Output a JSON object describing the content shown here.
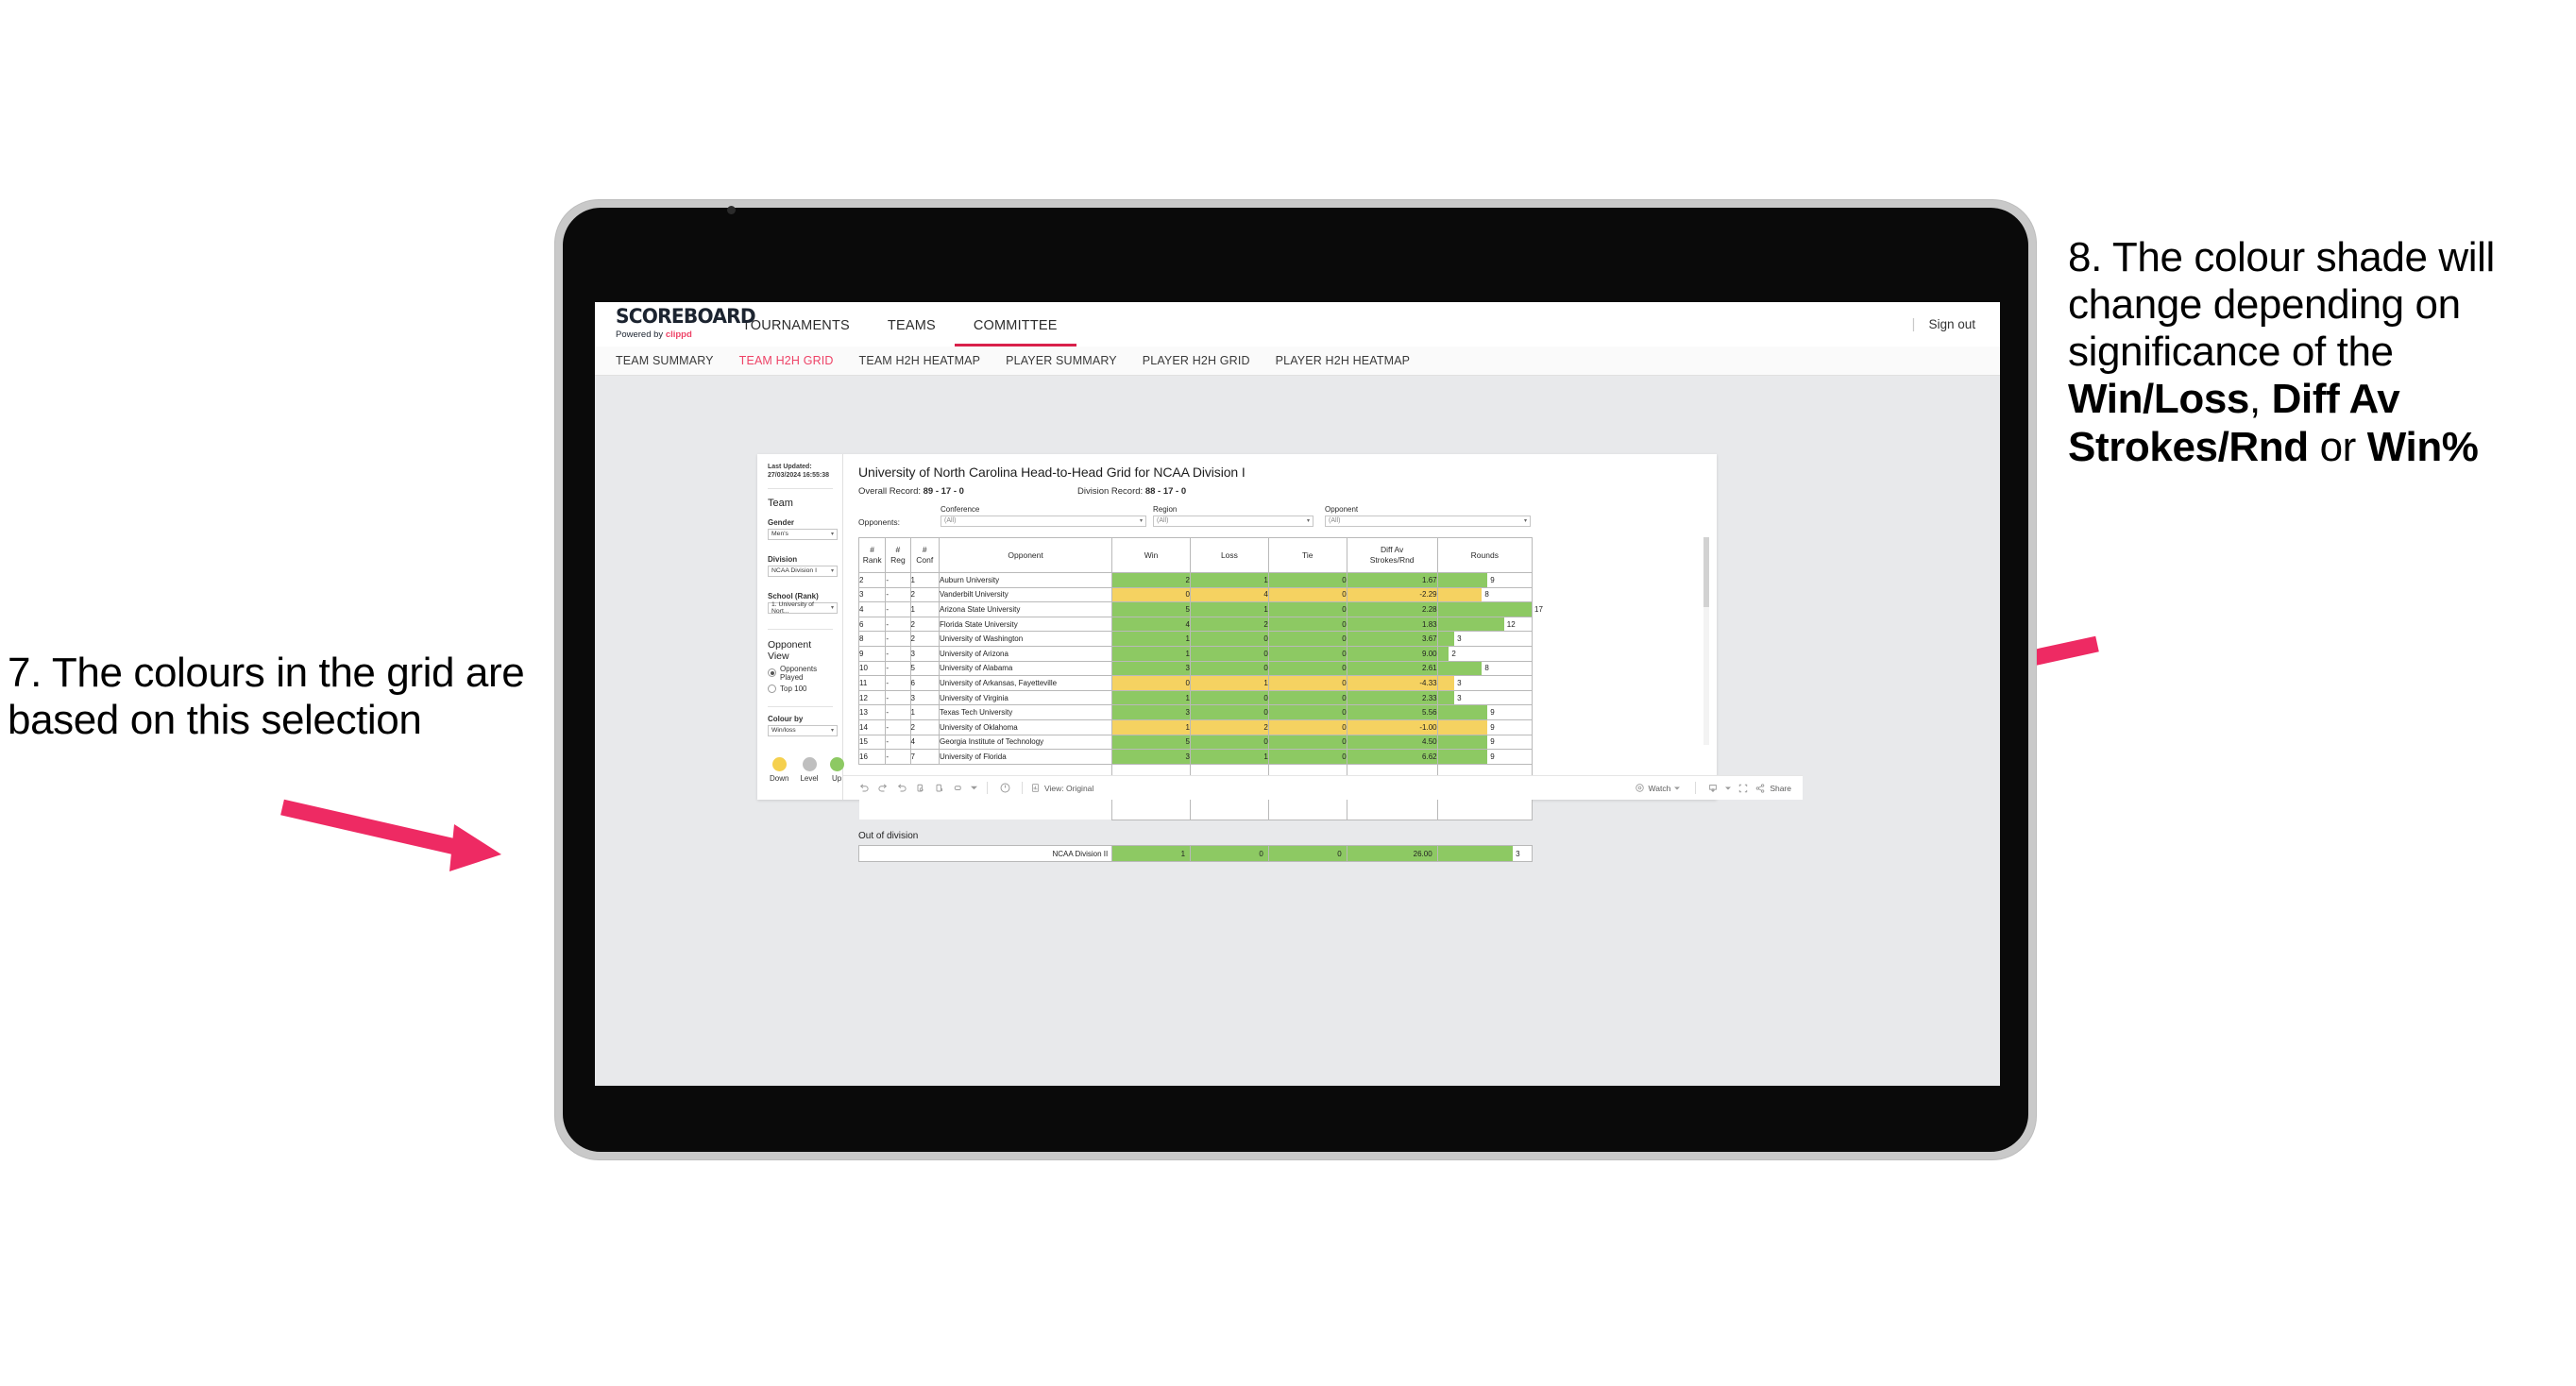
{
  "annotations": {
    "left": {
      "number": "7.",
      "text": "7. The colours in the grid are based on this selection"
    },
    "right": {
      "segments": [
        {
          "text": "8. The colour shade will change depending on significance of the ",
          "bold": false
        },
        {
          "text": "Win/Loss",
          "bold": true
        },
        {
          "text": ", ",
          "bold": false
        },
        {
          "text": "Diff Av Strokes/Rnd",
          "bold": true
        },
        {
          "text": " or ",
          "bold": false
        },
        {
          "text": "Win%",
          "bold": true
        }
      ],
      "plain": "8. The colour shade will change depending on significance of the Win/Loss, Diff Av Strokes/Rnd or Win%"
    },
    "arrow_color": "#ee2a63"
  },
  "app": {
    "brand": {
      "title": "SCOREBOARD",
      "powered_prefix": "Powered by ",
      "powered_brand": "clippd"
    },
    "main_nav": [
      {
        "label": "TOURNAMENTS",
        "active": false
      },
      {
        "label": "TEAMS",
        "active": false
      },
      {
        "label": "COMMITTEE",
        "active": true
      }
    ],
    "sign_out": "Sign out",
    "sign_out_divider": "|",
    "sub_nav": [
      {
        "label": "TEAM SUMMARY",
        "active": false
      },
      {
        "label": "TEAM H2H GRID",
        "active": true
      },
      {
        "label": "TEAM H2H HEATMAP",
        "active": false
      },
      {
        "label": "PLAYER SUMMARY",
        "active": false
      },
      {
        "label": "PLAYER H2H GRID",
        "active": false
      },
      {
        "label": "PLAYER H2H HEATMAP",
        "active": false
      }
    ],
    "accent_color": "#ee4266"
  },
  "sidebar": {
    "last_updated": "Last Updated: 27/03/2024 16:55:38",
    "team_heading": "Team",
    "gender": {
      "label": "Gender",
      "value": "Men's"
    },
    "division": {
      "label": "Division",
      "value": "NCAA Division I"
    },
    "school": {
      "label": "School (Rank)",
      "value": "1. University of Nort..."
    },
    "opponent_view": {
      "heading": "Opponent View",
      "options": [
        {
          "label": "Opponents Played",
          "selected": true
        },
        {
          "label": "Top 100",
          "selected": false
        }
      ]
    },
    "colour_by": {
      "label": "Colour by",
      "value": "Win/loss"
    },
    "legend": [
      {
        "caption": "Down",
        "color": "#f5d04e"
      },
      {
        "caption": "Level",
        "color": "#bfbfbf"
      },
      {
        "caption": "Up",
        "color": "#8dc963"
      }
    ]
  },
  "main": {
    "title": "University of North Carolina Head-to-Head Grid for NCAA Division I",
    "overall_record_label": "Overall Record: ",
    "overall_record_value": "89 - 17 - 0",
    "division_record_label": "Division Record: ",
    "division_record_value": "88 - 17 - 0",
    "opponents_label": "Opponents:",
    "filters": [
      {
        "label": "Conference",
        "value": "(All)"
      },
      {
        "label": "Region",
        "value": "(All)"
      },
      {
        "label": "Opponent",
        "value": "(All)"
      }
    ],
    "table": {
      "headers": [
        {
          "line1": "#",
          "line2": "Rank"
        },
        {
          "line1": "#",
          "line2": "Reg"
        },
        {
          "line1": "#",
          "line2": "Conf"
        },
        {
          "line1": "",
          "line2": "Opponent"
        },
        {
          "line1": "",
          "line2": "Win"
        },
        {
          "line1": "",
          "line2": "Loss"
        },
        {
          "line1": "",
          "line2": "Tie"
        },
        {
          "line1": "Diff Av",
          "line2": "Strokes/Rnd"
        },
        {
          "line1": "",
          "line2": "Rounds"
        }
      ],
      "rows": [
        {
          "rank": "2",
          "reg": "-",
          "conf": "1",
          "opponent": "Auburn University",
          "win": "2",
          "loss": "1",
          "tie": "0",
          "diff": "1.67",
          "rounds": "9",
          "state": "up"
        },
        {
          "rank": "3",
          "reg": "-",
          "conf": "2",
          "opponent": "Vanderbilt University",
          "win": "0",
          "loss": "4",
          "tie": "0",
          "diff": "-2.29",
          "rounds": "8",
          "state": "down"
        },
        {
          "rank": "4",
          "reg": "-",
          "conf": "1",
          "opponent": "Arizona State University",
          "win": "5",
          "loss": "1",
          "tie": "0",
          "diff": "2.28",
          "rounds": "17",
          "state": "up"
        },
        {
          "rank": "6",
          "reg": "-",
          "conf": "2",
          "opponent": "Florida State University",
          "win": "4",
          "loss": "2",
          "tie": "0",
          "diff": "1.83",
          "rounds": "12",
          "state": "up"
        },
        {
          "rank": "8",
          "reg": "-",
          "conf": "2",
          "opponent": "University of Washington",
          "win": "1",
          "loss": "0",
          "tie": "0",
          "diff": "3.67",
          "rounds": "3",
          "state": "up"
        },
        {
          "rank": "9",
          "reg": "-",
          "conf": "3",
          "opponent": "University of Arizona",
          "win": "1",
          "loss": "0",
          "tie": "0",
          "diff": "9.00",
          "rounds": "2",
          "state": "up"
        },
        {
          "rank": "10",
          "reg": "-",
          "conf": "5",
          "opponent": "University of Alabama",
          "win": "3",
          "loss": "0",
          "tie": "0",
          "diff": "2.61",
          "rounds": "8",
          "state": "up"
        },
        {
          "rank": "11",
          "reg": "-",
          "conf": "6",
          "opponent": "University of Arkansas, Fayetteville",
          "win": "0",
          "loss": "1",
          "tie": "0",
          "diff": "-4.33",
          "rounds": "3",
          "state": "down"
        },
        {
          "rank": "12",
          "reg": "-",
          "conf": "3",
          "opponent": "University of Virginia",
          "win": "1",
          "loss": "0",
          "tie": "0",
          "diff": "2.33",
          "rounds": "3",
          "state": "up"
        },
        {
          "rank": "13",
          "reg": "-",
          "conf": "1",
          "opponent": "Texas Tech University",
          "win": "3",
          "loss": "0",
          "tie": "0",
          "diff": "5.56",
          "rounds": "9",
          "state": "up"
        },
        {
          "rank": "14",
          "reg": "-",
          "conf": "2",
          "opponent": "University of Oklahoma",
          "win": "1",
          "loss": "2",
          "tie": "0",
          "diff": "-1.00",
          "rounds": "9",
          "state": "down"
        },
        {
          "rank": "15",
          "reg": "-",
          "conf": "4",
          "opponent": "Georgia Institute of Technology",
          "win": "5",
          "loss": "0",
          "tie": "0",
          "diff": "4.50",
          "rounds": "9",
          "state": "up"
        },
        {
          "rank": "16",
          "reg": "-",
          "conf": "7",
          "opponent": "University of Florida",
          "win": "3",
          "loss": "1",
          "tie": "0",
          "diff": "6.62",
          "rounds": "9",
          "state": "up"
        }
      ],
      "max_rounds": 17,
      "colors": {
        "up": "#8dc963",
        "down": "#f5d261",
        "level": "#bfbfbf"
      }
    },
    "out_of_division": {
      "title": "Out of division",
      "row": {
        "name": "NCAA Division II",
        "win": "1",
        "loss": "0",
        "tie": "0",
        "diff": "26.00",
        "rounds": "3",
        "state": "up"
      }
    },
    "toolbar": {
      "view_label": "View: Original",
      "watch_label": "Watch",
      "share_label": "Share"
    }
  },
  "chart_data": {
    "type": "table",
    "title": "University of North Carolina Head-to-Head Grid for NCAA Division I",
    "columns": [
      "# Rank",
      "# Reg",
      "# Conf",
      "Opponent",
      "Win",
      "Loss",
      "Tie",
      "Diff Av Strokes/Rnd",
      "Rounds"
    ],
    "rows": [
      [
        "2",
        "-",
        "1",
        "Auburn University",
        2,
        1,
        0,
        1.67,
        9
      ],
      [
        "3",
        "-",
        "2",
        "Vanderbilt University",
        0,
        4,
        0,
        -2.29,
        8
      ],
      [
        "4",
        "-",
        "1",
        "Arizona State University",
        5,
        1,
        0,
        2.28,
        17
      ],
      [
        "6",
        "-",
        "2",
        "Florida State University",
        4,
        2,
        0,
        1.83,
        12
      ],
      [
        "8",
        "-",
        "2",
        "University of Washington",
        1,
        0,
        0,
        3.67,
        3
      ],
      [
        "9",
        "-",
        "3",
        "University of Arizona",
        1,
        0,
        0,
        9.0,
        2
      ],
      [
        "10",
        "-",
        "5",
        "University of Alabama",
        3,
        0,
        0,
        2.61,
        8
      ],
      [
        "11",
        "-",
        "6",
        "University of Arkansas, Fayetteville",
        0,
        1,
        0,
        -4.33,
        3
      ],
      [
        "12",
        "-",
        "3",
        "University of Virginia",
        1,
        0,
        0,
        2.33,
        3
      ],
      [
        "13",
        "-",
        "1",
        "Texas Tech University",
        3,
        0,
        0,
        5.56,
        9
      ],
      [
        "14",
        "-",
        "2",
        "University of Oklahoma",
        1,
        2,
        0,
        -1.0,
        9
      ],
      [
        "15",
        "-",
        "4",
        "Georgia Institute of Technology",
        5,
        0,
        0,
        4.5,
        9
      ],
      [
        "16",
        "-",
        "7",
        "University of Florida",
        3,
        1,
        0,
        6.62,
        9
      ]
    ],
    "out_of_division_rows": [
      [
        "NCAA Division II",
        1,
        0,
        0,
        26.0,
        3
      ]
    ],
    "color_encoding": {
      "field": "Win/loss",
      "up": "#8dc963",
      "down": "#f5d261",
      "level": "#bfbfbf"
    },
    "bar_column": "Rounds",
    "bar_max": 17,
    "overall_record": "89 - 17 - 0",
    "division_record": "88 - 17 - 0"
  }
}
